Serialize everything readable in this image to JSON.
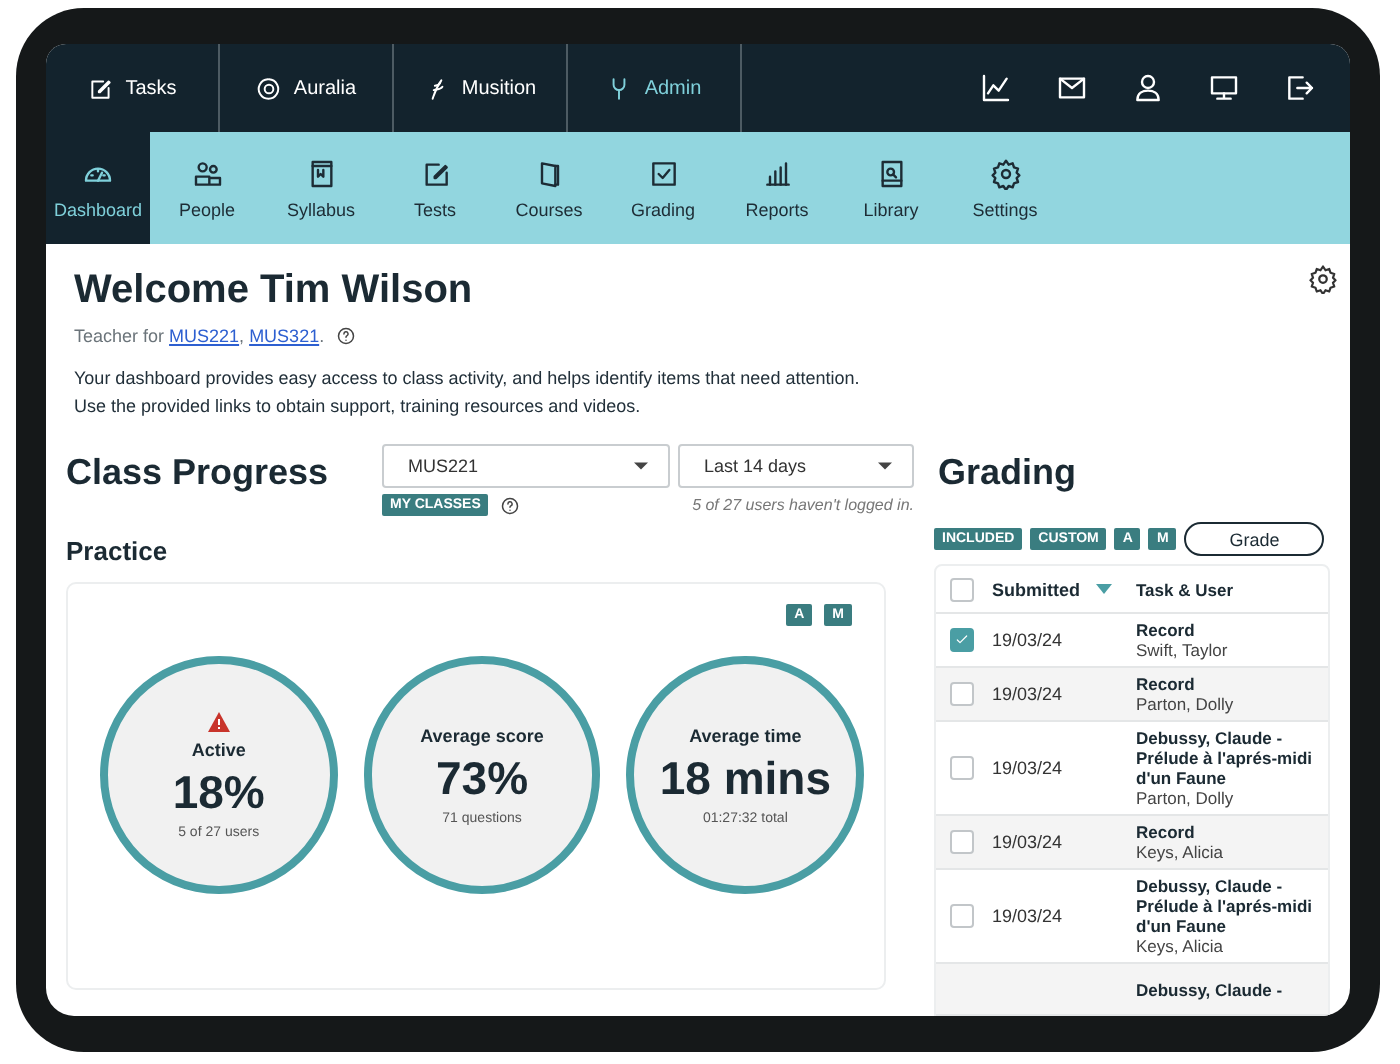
{
  "top_tabs": [
    {
      "label": "Tasks",
      "selected": false
    },
    {
      "label": "Auralia",
      "selected": false
    },
    {
      "label": "Musition",
      "selected": false
    },
    {
      "label": "Admin",
      "selected": true
    }
  ],
  "nav": [
    {
      "label": "Dashboard",
      "selected": true
    },
    {
      "label": "People",
      "selected": false
    },
    {
      "label": "Syllabus",
      "selected": false
    },
    {
      "label": "Tests",
      "selected": false
    },
    {
      "label": "Courses",
      "selected": false
    },
    {
      "label": "Grading",
      "selected": false
    },
    {
      "label": "Reports",
      "selected": false
    },
    {
      "label": "Library",
      "selected": false
    },
    {
      "label": "Settings",
      "selected": false
    }
  ],
  "welcome": {
    "title": "Welcome Tim Wilson",
    "teacher_line": {
      "prefix": "Teacher for",
      "links": [
        "MUS221",
        "MUS321"
      ],
      "separator": ",",
      "suffix": "."
    },
    "description": [
      "Your dashboard provides easy access to class activity, and helps identify items that need attention.",
      "Use the provided links to obtain support, training resources and videos."
    ]
  },
  "class_progress": {
    "title": "Class Progress",
    "class_select": "MUS221",
    "period_select": "Last 14 days",
    "badge": "MY CLASSES",
    "note": "5 of 27 users haven't logged in."
  },
  "practice": {
    "title": "Practice",
    "toggles": [
      "A",
      "M"
    ],
    "stats": [
      {
        "label": "Active",
        "value": "18%",
        "detail": "5 of 27 users",
        "warning": true
      },
      {
        "label": "Average score",
        "value": "73%",
        "detail": "71 questions",
        "warning": false
      },
      {
        "label": "Average time",
        "value": "18 mins",
        "detail": "01:27:32 total",
        "warning": false
      }
    ]
  },
  "grading": {
    "title": "Grading",
    "filters": [
      "INCLUDED",
      "CUSTOM",
      "A",
      "M"
    ],
    "button": "Grade",
    "all_checked": false,
    "columns": [
      {
        "label": "Submitted",
        "sorted": true
      },
      {
        "label": "Task & User",
        "sorted": false
      }
    ],
    "rows": [
      {
        "checked": true,
        "date": "19/03/24",
        "task": "Record",
        "user": "Swift, Taylor"
      },
      {
        "checked": false,
        "date": "19/03/24",
        "task": "Record",
        "user": "Parton, Dolly"
      },
      {
        "checked": false,
        "date": "19/03/24",
        "task": "Debussy, Claude - Prélude à l'aprés-midi d'un Faune",
        "user": "Parton, Dolly"
      },
      {
        "checked": false,
        "date": "19/03/24",
        "task": "Record",
        "user": "Keys, Alicia"
      },
      {
        "checked": false,
        "date": "19/03/24",
        "task": "Debussy, Claude - Prélude à l'aprés-midi d'un Faune",
        "user": "Keys, Alicia"
      },
      {
        "task": "Debussy, Claude -"
      }
    ]
  }
}
